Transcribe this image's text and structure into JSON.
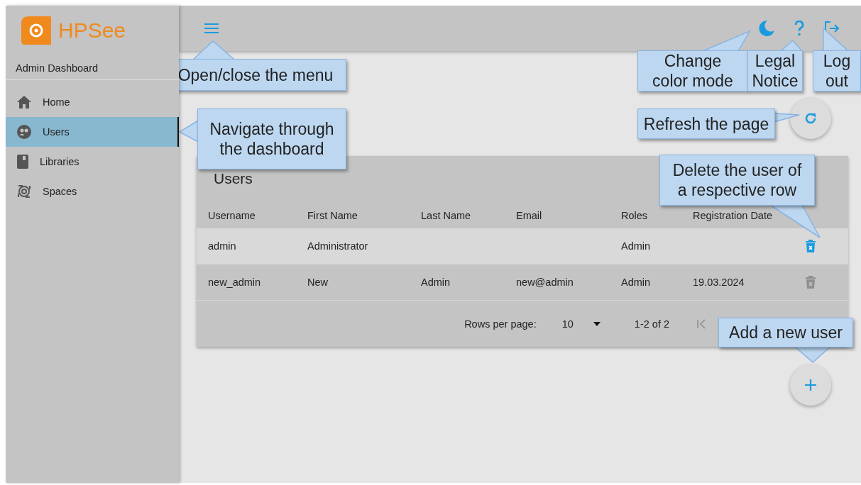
{
  "sidebar": {
    "logo_text": "HPSee",
    "subtitle": "Admin Dashboard",
    "items": [
      {
        "label": "Home",
        "selected": false
      },
      {
        "label": "Users",
        "selected": true
      },
      {
        "label": "Libraries",
        "selected": false
      },
      {
        "label": "Spaces",
        "selected": false
      }
    ]
  },
  "table": {
    "title": "Users",
    "columns": [
      "Username",
      "First Name",
      "Last Name",
      "Email",
      "Roles",
      "Registration Date"
    ],
    "rows": [
      {
        "cells": [
          "admin",
          "Administrator",
          "",
          "",
          "Admin",
          ""
        ],
        "highlighted": true,
        "delete_disabled": false
      },
      {
        "cells": [
          "new_admin",
          "New",
          "Admin",
          "new@admin",
          "Admin",
          "19.03.2024"
        ],
        "highlighted": false,
        "delete_disabled": true
      }
    ],
    "footer": {
      "rows_per_page_label": "Rows per page:",
      "rows_per_page": "10",
      "range": "1-2 of 2"
    }
  },
  "callouts": [
    {
      "text": "Open/close the menu"
    },
    {
      "text": "Navigate through\nthe dashboard"
    },
    {
      "text": "Change\ncolor mode"
    },
    {
      "text": "Legal\nNotice"
    },
    {
      "text": "Log\nout"
    },
    {
      "text": "Refresh the page"
    },
    {
      "text": "Delete the user of\na respective row"
    },
    {
      "text": "Add a new user"
    }
  ]
}
